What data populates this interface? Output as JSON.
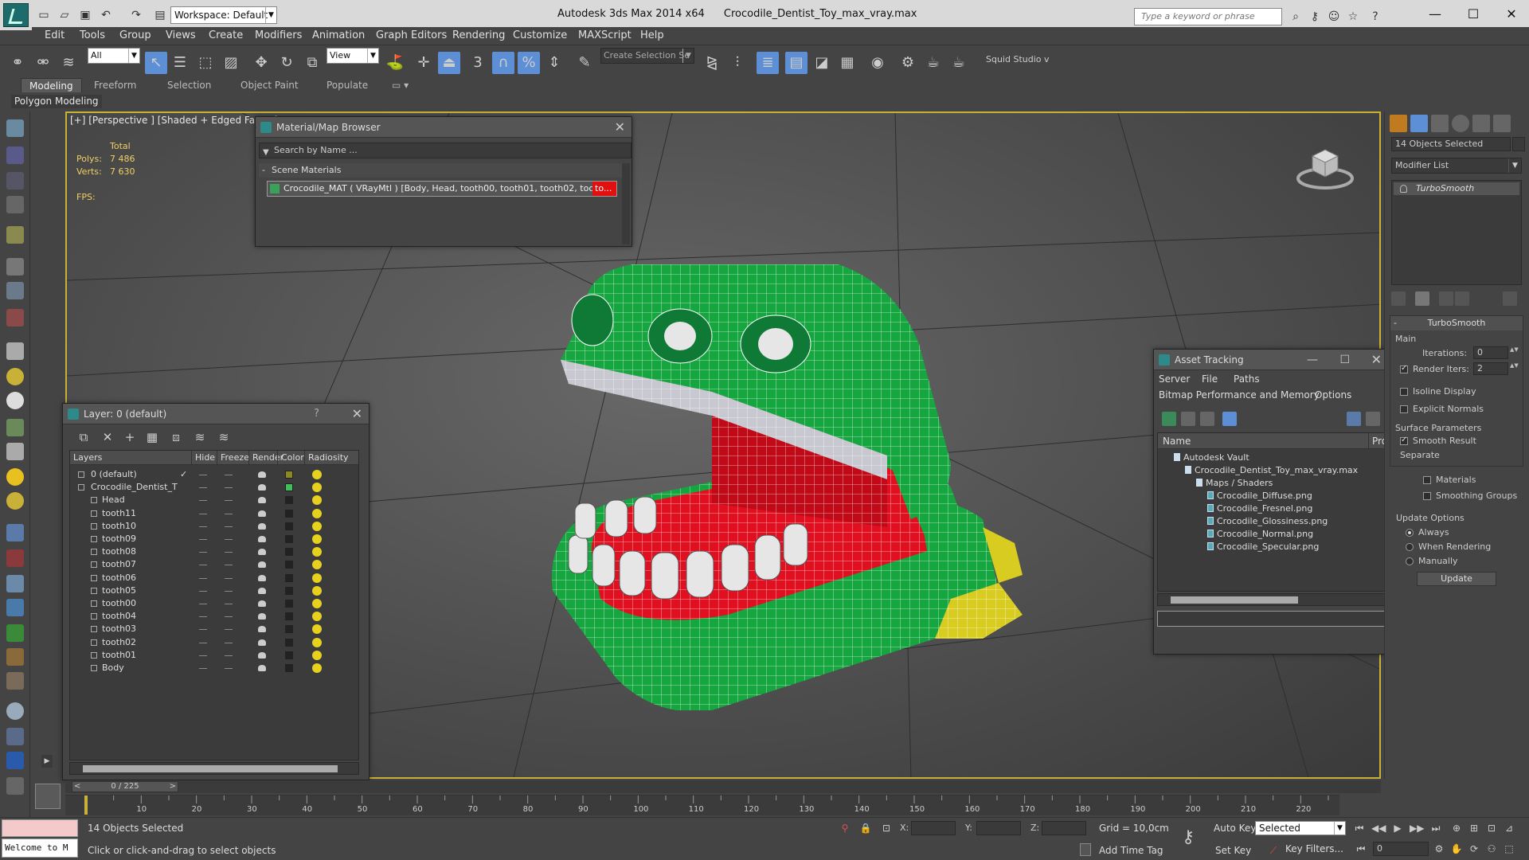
{
  "window": {
    "app_title": "Autodesk 3ds Max  2014 x64",
    "file_title": "Crocodile_Dentist_Toy_max_vray.max",
    "workspace": "Workspace: Default",
    "search_placeholder": "Type a keyword or phrase",
    "minimize": "—",
    "maximize": "☐",
    "close": "✕"
  },
  "menu": [
    "Edit",
    "Tools",
    "Group",
    "Views",
    "Create",
    "Modifiers",
    "Animation",
    "Graph Editors",
    "Rendering",
    "Customize",
    "MAXScript",
    "Help"
  ],
  "toolbar": {
    "selection_filter": "All",
    "ref_coord": "View",
    "named_selection": "Create Selection Se",
    "snap_3d": "3",
    "squid": "Squid Studio v"
  },
  "ribbon": {
    "tabs": [
      "Modeling",
      "Freeform",
      "Selection",
      "Object Paint",
      "Populate"
    ],
    "active_tab": "Modeling",
    "sub_label": "Polygon Modeling"
  },
  "viewport": {
    "label": "[+] [Perspective ] [Shaded + Edged Faces ]",
    "stats_total": "Total",
    "polys_label": "Polys:",
    "polys_value": "7 486",
    "verts_label": "Verts:",
    "verts_value": "7 630",
    "fps_label": "FPS:"
  },
  "material_browser": {
    "title": "Material/Map Browser",
    "search_placeholder": "Search by Name ...",
    "section": "Scene Materials",
    "entry": "Crocodile_MAT ( VRayMtl ) [Body, Head, tooth00, tooth01, tooth02, tooth03, to"
  },
  "layer_explorer": {
    "title": "Layer: 0 (default)",
    "help": "?",
    "columns": [
      "Layers",
      "Hide",
      "Freeze",
      "Render",
      "Color",
      "Radiosity"
    ],
    "rows": [
      {
        "name": "0 (default)",
        "color": "#8a8a20",
        "level": 0,
        "type": "layer"
      },
      {
        "name": "Crocodile_Dentist_T",
        "color": "#3fbf5a",
        "level": 0,
        "type": "layer"
      },
      {
        "name": "Head",
        "color": "#222222",
        "level": 1,
        "type": "object"
      },
      {
        "name": "tooth11",
        "color": "#222222",
        "level": 1,
        "type": "object"
      },
      {
        "name": "tooth10",
        "color": "#222222",
        "level": 1,
        "type": "object"
      },
      {
        "name": "tooth09",
        "color": "#222222",
        "level": 1,
        "type": "object"
      },
      {
        "name": "tooth08",
        "color": "#222222",
        "level": 1,
        "type": "object"
      },
      {
        "name": "tooth07",
        "color": "#222222",
        "level": 1,
        "type": "object"
      },
      {
        "name": "tooth06",
        "color": "#222222",
        "level": 1,
        "type": "object"
      },
      {
        "name": "tooth05",
        "color": "#222222",
        "level": 1,
        "type": "object"
      },
      {
        "name": "tooth00",
        "color": "#222222",
        "level": 1,
        "type": "object"
      },
      {
        "name": "tooth04",
        "color": "#222222",
        "level": 1,
        "type": "object"
      },
      {
        "name": "tooth03",
        "color": "#222222",
        "level": 1,
        "type": "object"
      },
      {
        "name": "tooth02",
        "color": "#222222",
        "level": 1,
        "type": "object"
      },
      {
        "name": "tooth01",
        "color": "#222222",
        "level": 1,
        "type": "object"
      },
      {
        "name": "Body",
        "color": "#222222",
        "level": 1,
        "type": "object"
      }
    ]
  },
  "asset_tracking": {
    "title": "Asset Tracking",
    "menu": [
      "Server",
      "File",
      "Paths",
      "Bitmap Performance and Memory",
      "Options"
    ],
    "col_name": "Name",
    "col_pro": "Pro",
    "tree": [
      {
        "name": "Autodesk Vault",
        "level": 0
      },
      {
        "name": "Crocodile_Dentist_Toy_max_vray.max",
        "level": 1
      },
      {
        "name": "Maps / Shaders",
        "level": 2
      },
      {
        "name": "Crocodile_Diffuse.png",
        "level": 3
      },
      {
        "name": "Crocodile_Fresnel.png",
        "level": 3
      },
      {
        "name": "Crocodile_Glossiness.png",
        "level": 3
      },
      {
        "name": "Crocodile_Normal.png",
        "level": 3
      },
      {
        "name": "Crocodile_Specular.png",
        "level": 3
      }
    ]
  },
  "command_panel": {
    "selection": "14 Objects Selected",
    "modifier_list": "Modifier List",
    "stack_item": "TurboSmooth",
    "rollout_title": "TurboSmooth",
    "main_label": "Main",
    "iterations_label": "Iterations:",
    "iterations_value": "0",
    "render_iters_label": "Render Iters:",
    "render_iters_value": "2",
    "isoline": "Isoline Display",
    "explicit_normals": "Explicit Normals",
    "surface_params": "Surface Parameters",
    "smooth_result": "Smooth Result",
    "separate": "Separate",
    "materials": "Materials",
    "smoothing_groups": "Smoothing Groups",
    "update_options": "Update Options",
    "always": "Always",
    "when_rendering": "When Rendering",
    "manually": "Manually",
    "update_button": "Update"
  },
  "timeline": {
    "slider": "0 / 225",
    "ticks": [
      "10",
      "20",
      "30",
      "40",
      "50",
      "60",
      "70",
      "80",
      "90",
      "100",
      "110",
      "120",
      "130",
      "140",
      "150",
      "160",
      "170",
      "180",
      "190",
      "200",
      "210",
      "220"
    ]
  },
  "status": {
    "maxscript": "Welcome to M",
    "selected": "14 Objects Selected",
    "prompt": "Click or click-and-drag to select objects",
    "x_label": "X:",
    "y_label": "Y:",
    "z_label": "Z:",
    "grid": "Grid = 10,0cm",
    "add_time_tag": "Add Time Tag",
    "auto_key": "Auto Key",
    "set_key": "Set Key",
    "selected_combo": "Selected",
    "key_filters": "Key Filters...",
    "frame": "0"
  },
  "colors": {
    "viewport_border": "#c9b037",
    "croc_green": "#16a640",
    "croc_red": "#e01020",
    "tooth_white": "#e6e6e6",
    "foot_yellow": "#d8cc20",
    "active_tool": "#5d8fd6"
  }
}
